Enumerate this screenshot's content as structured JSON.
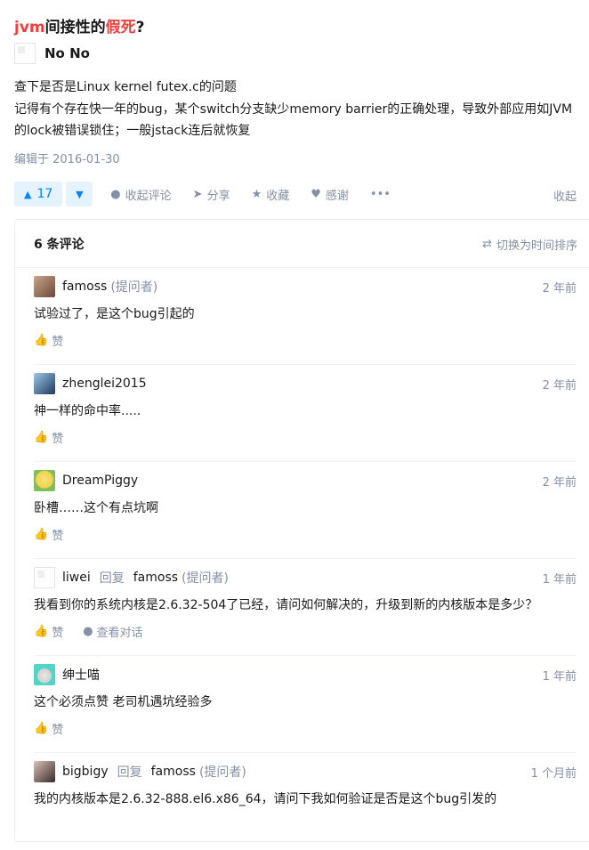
{
  "question": {
    "title_parts": [
      "jvm",
      "间接性的",
      "假死",
      "?"
    ]
  },
  "answer": {
    "author": "No No",
    "lines": [
      "查下是否是Linux kernel futex.c的问题",
      "记得有个存在快一年的bug，某个switch分支缺少memory barrier的正确处理，导致外部应用如JVM的lock被错误锁住；一般jstack连后就恢复"
    ],
    "edited": "编辑于 2016-01-30"
  },
  "actions": {
    "vote_count": "17",
    "collapse_comments": "收起评论",
    "share": "分享",
    "favorite": "收藏",
    "thanks": "感谢",
    "more": "•••",
    "collapse": "收起"
  },
  "comments_panel": {
    "count": "6 条评论",
    "sort": "切换为时间排序"
  },
  "comments": [
    {
      "user": "famoss",
      "tag": "(提问者)",
      "time": "2 年前",
      "text": "试验过了，是这个bug引起的",
      "like": "赞"
    },
    {
      "user": "zhenglei2015",
      "tag": "",
      "time": "2 年前",
      "text": "神一样的命中率.....",
      "like": "赞"
    },
    {
      "user": "DreamPiggy",
      "tag": "",
      "time": "2 年前",
      "text": "卧槽……这个有点坑啊",
      "like": "赞"
    },
    {
      "user": "liwei",
      "reply_word": "回复",
      "reply_to": "famoss",
      "reply_tag": "(提问者)",
      "time": "1 年前",
      "text": "我看到你的系统内核是2.6.32-504了已经，请问如何解决的，升级到新的内核版本是多少？",
      "like": "赞",
      "view_dialog": "查看对话"
    },
    {
      "user": "绅士喵",
      "tag": "",
      "time": "1 年前",
      "text": "这个必须点赞 老司机遇坑经验多",
      "like": "赞"
    },
    {
      "user": "bigbigy",
      "reply_word": "回复",
      "reply_to": "famoss",
      "reply_tag": "(提问者)",
      "time": "1 个月前",
      "text": "我的内核版本是2.6.32-888.el6.x86_64，请问下我如何验证是否是这个bug引发的",
      "like": "赞"
    }
  ],
  "colors": {
    "accent": "#0084ff",
    "highlight": "#f1403c",
    "muted": "#8590a6"
  }
}
